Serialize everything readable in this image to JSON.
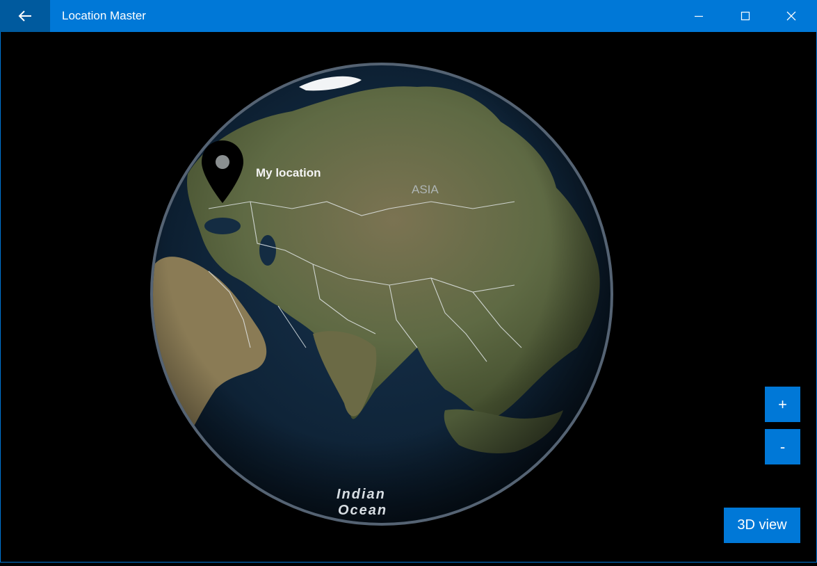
{
  "window": {
    "title": "Location Master",
    "back_icon": "arrow-left-icon",
    "minimize_icon": "minimize-icon",
    "maximize_icon": "maximize-icon",
    "close_icon": "close-icon",
    "accent_color": "#0078d7"
  },
  "map": {
    "style": "aerial-globe",
    "pin_label": "My location",
    "continent_label": "ASIA",
    "ocean_label_line1": "Indian",
    "ocean_label_line2": "Ocean"
  },
  "controls": {
    "zoom_in_label": "+",
    "zoom_out_label": "-",
    "view3d_label": "3D view"
  }
}
